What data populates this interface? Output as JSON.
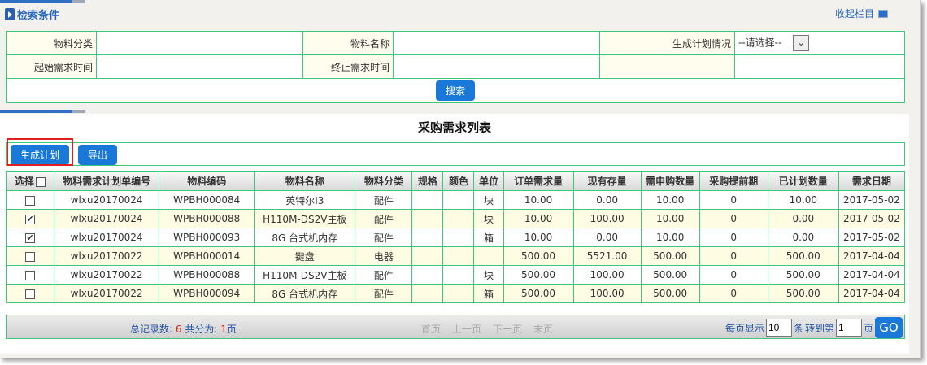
{
  "search": {
    "section_title": "检索条件",
    "collapse_label": "收起栏目",
    "labels": {
      "category": "物料分类",
      "name": "物料名称",
      "plan_status": "生成计划情况",
      "start_time": "起始需求时间",
      "end_time": "终止需求时间"
    },
    "plan_status_value": "--请选择--",
    "search_button": "搜索"
  },
  "list": {
    "title": "采购需求列表",
    "generate_button": "生成计划",
    "export_button": "导出",
    "columns": [
      "选择",
      "物料需求计划单编号",
      "物料编码",
      "物料名称",
      "物料分类",
      "规格",
      "颜色",
      "单位",
      "订单需求量",
      "现有存量",
      "需申购数量",
      "采购提前期",
      "已计划数量",
      "需求日期"
    ],
    "rows": [
      {
        "checked": false,
        "cells": [
          "wlxu20170024",
          "WPBH000084",
          "英特尔I3",
          "配件",
          "",
          "",
          "块",
          "10.00",
          "0.00",
          "10.00",
          "0",
          "10.00",
          "2017-05-02"
        ]
      },
      {
        "checked": true,
        "cells": [
          "wlxu20170024",
          "WPBH000088",
          "H110M-DS2V主板",
          "配件",
          "",
          "",
          "块",
          "10.00",
          "100.00",
          "10.00",
          "0",
          "0.00",
          "2017-05-02"
        ]
      },
      {
        "checked": true,
        "cells": [
          "wlxu20170024",
          "WPBH000093",
          "8G 台式机内存",
          "配件",
          "",
          "",
          "箱",
          "10.00",
          "0.00",
          "10.00",
          "0",
          "0.00",
          "2017-05-02"
        ]
      },
      {
        "checked": false,
        "cells": [
          "wlxu20170022",
          "WPBH000014",
          "键盘",
          "电器",
          "",
          "",
          "",
          "500.00",
          "5521.00",
          "500.00",
          "0",
          "500.00",
          "2017-04-04"
        ]
      },
      {
        "checked": false,
        "cells": [
          "wlxu20170022",
          "WPBH000088",
          "H110M-DS2V主板",
          "配件",
          "",
          "",
          "块",
          "500.00",
          "100.00",
          "500.00",
          "0",
          "500.00",
          "2017-04-04"
        ]
      },
      {
        "checked": false,
        "cells": [
          "wlxu20170022",
          "WPBH000094",
          "8G 台式机内存",
          "配件",
          "",
          "",
          "箱",
          "500.00",
          "100.00",
          "500.00",
          "0",
          "500.00",
          "2017-04-04"
        ]
      }
    ]
  },
  "pager": {
    "total_label": "总记录数:",
    "total": "6",
    "pages_label": "共分为:",
    "pages": "1",
    "page_unit": "页",
    "first": "首页",
    "prev": "上一页",
    "next": "下一页",
    "last": "末页",
    "per_page_label": "每页显示",
    "per_page": "10",
    "per_page_unit": "条",
    "goto_label": "转到第",
    "goto_page": "1",
    "goto_unit": "页",
    "go": "GO"
  }
}
